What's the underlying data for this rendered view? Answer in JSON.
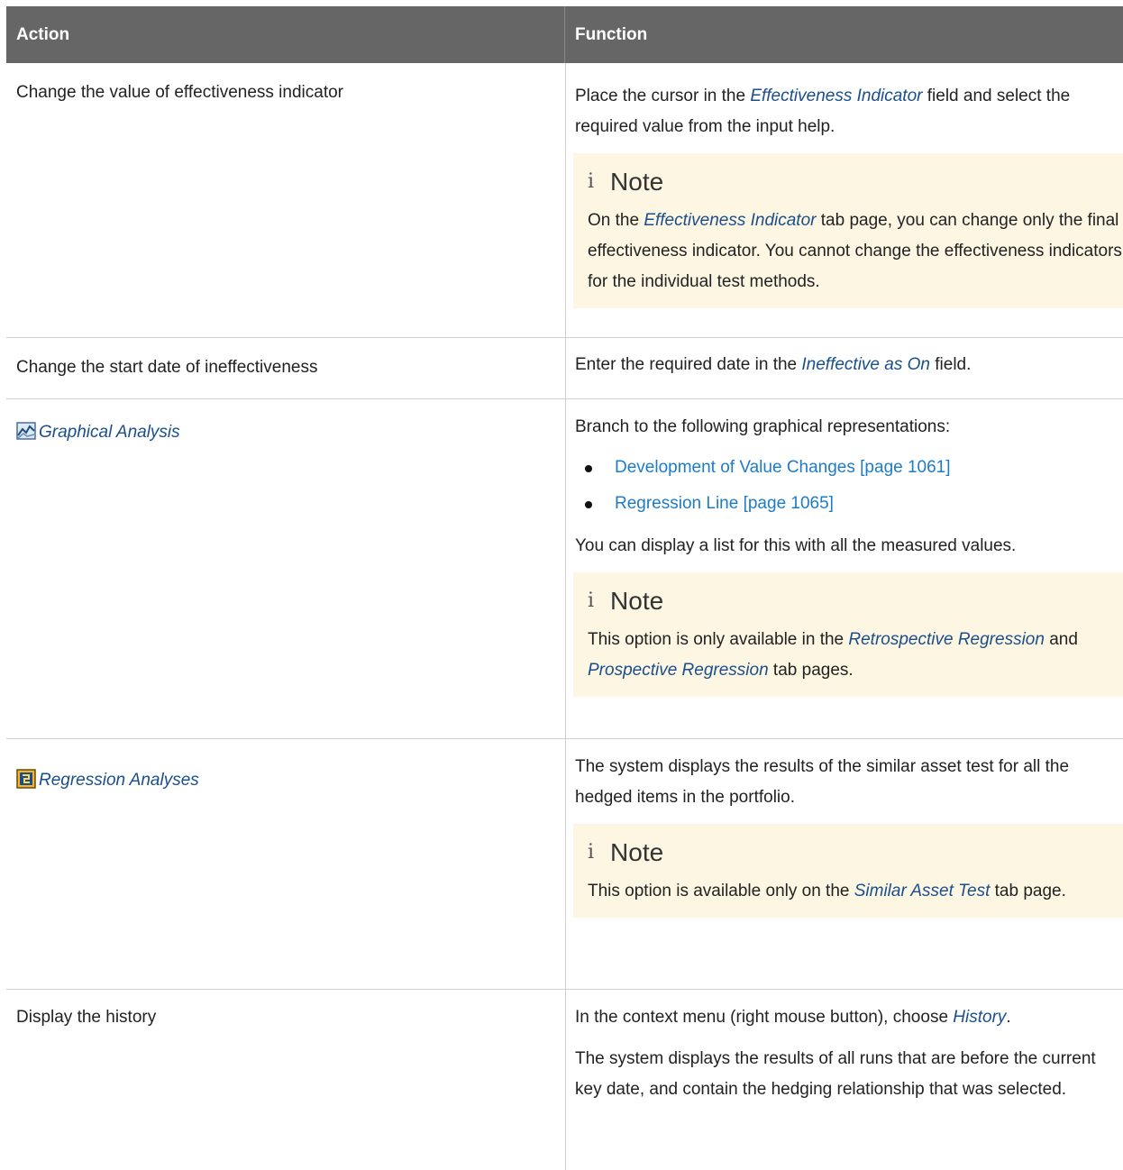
{
  "table": {
    "headers": {
      "action": "Action",
      "function": "Function"
    },
    "rows": [
      {
        "action": "Change the value of effectiveness indicator",
        "f1_pre": "Place the cursor in the ",
        "f1_term": "Effectiveness Indicator",
        "f1_post": " field and select the required value from the input help.",
        "note_label": "Note",
        "note_pre": "On the ",
        "note_term": "Effectiveness Indicator",
        "note_post": " tab page, you can change only the final effectiveness indicator. You cannot change the effectiveness indicators for the individual test methods."
      },
      {
        "action": "Change the start date of ineffectiveness",
        "f1_pre": "Enter the required date in the ",
        "f1_term": "Ineffective as On",
        "f1_post": " field."
      },
      {
        "action_icon": "graph-icon",
        "action": "Graphical Analysis",
        "f1": "Branch to the following graphical representations:",
        "links": [
          "Development of Value Changes [page 1061]",
          "Regression Line [page 1065]"
        ],
        "f2": "You can display a list for this with all the measured values.",
        "note_label": "Note",
        "note_pre": "This option is only available in the ",
        "note_term1": "Retrospective Regression",
        "note_mid": " and ",
        "note_term2": "Prospective Regression",
        "note_post": " tab pages."
      },
      {
        "action_icon": "regression-icon",
        "action": "Regression Analyses",
        "f1": "The system displays the results of the similar asset test for all the hedged items in the portfolio.",
        "note_label": "Note",
        "note_pre": "This option is available only on the ",
        "note_term": "Similar Asset Test",
        "note_post": " tab page."
      },
      {
        "action": "Display the history",
        "f1_pre": "In the context menu (right mouse button), choose ",
        "f1_term": "History",
        "f1_post": ".",
        "f2": "The system displays the results of all runs that are before the current key date, and contain the hedging relationship that was selected."
      }
    ]
  },
  "note_glyph": "i",
  "colors": {
    "header_bg": "#666666",
    "note_bg": "#fdf6e3",
    "term": "#1a4f8b",
    "link": "#1e7bc8"
  }
}
